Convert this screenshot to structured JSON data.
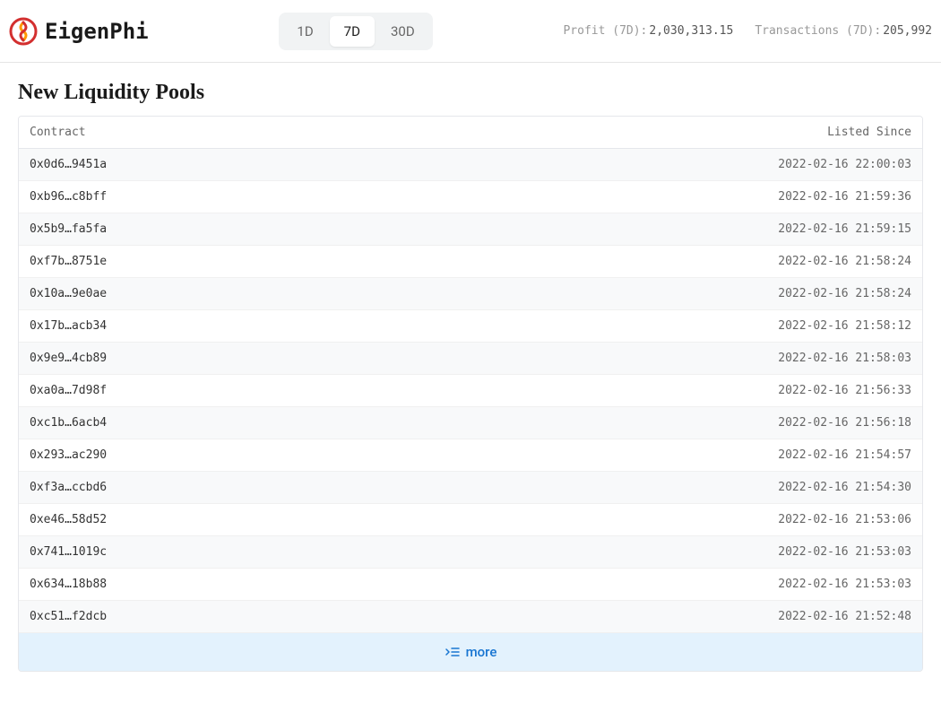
{
  "header": {
    "logo_text": "EigenPhi",
    "tabs": {
      "tab_1d": "1D",
      "tab_7d": "7D",
      "tab_30d": "30D"
    },
    "stats": {
      "profit_label": "Profit (7D):",
      "profit_value": "2,030,313.15",
      "transactions_label": "Transactions (7D):",
      "transactions_value": "205,992"
    }
  },
  "section": {
    "title": "New Liquidity Pools",
    "columns": {
      "contract": "Contract",
      "listed_since": "Listed Since"
    },
    "rows": [
      {
        "contract": "0x0d6…9451a",
        "listed": "2022-02-16 22:00:03"
      },
      {
        "contract": "0xb96…c8bff",
        "listed": "2022-02-16 21:59:36"
      },
      {
        "contract": "0x5b9…fa5fa",
        "listed": "2022-02-16 21:59:15"
      },
      {
        "contract": "0xf7b…8751e",
        "listed": "2022-02-16 21:58:24"
      },
      {
        "contract": "0x10a…9e0ae",
        "listed": "2022-02-16 21:58:24"
      },
      {
        "contract": "0x17b…acb34",
        "listed": "2022-02-16 21:58:12"
      },
      {
        "contract": "0x9e9…4cb89",
        "listed": "2022-02-16 21:58:03"
      },
      {
        "contract": "0xa0a…7d98f",
        "listed": "2022-02-16 21:56:33"
      },
      {
        "contract": "0xc1b…6acb4",
        "listed": "2022-02-16 21:56:18"
      },
      {
        "contract": "0x293…ac290",
        "listed": "2022-02-16 21:54:57"
      },
      {
        "contract": "0xf3a…ccbd6",
        "listed": "2022-02-16 21:54:30"
      },
      {
        "contract": "0xe46…58d52",
        "listed": "2022-02-16 21:53:06"
      },
      {
        "contract": "0x741…1019c",
        "listed": "2022-02-16 21:53:03"
      },
      {
        "contract": "0x634…18b88",
        "listed": "2022-02-16 21:53:03"
      },
      {
        "contract": "0xc51…f2dcb",
        "listed": "2022-02-16 21:52:48"
      }
    ],
    "more_label": "more"
  }
}
